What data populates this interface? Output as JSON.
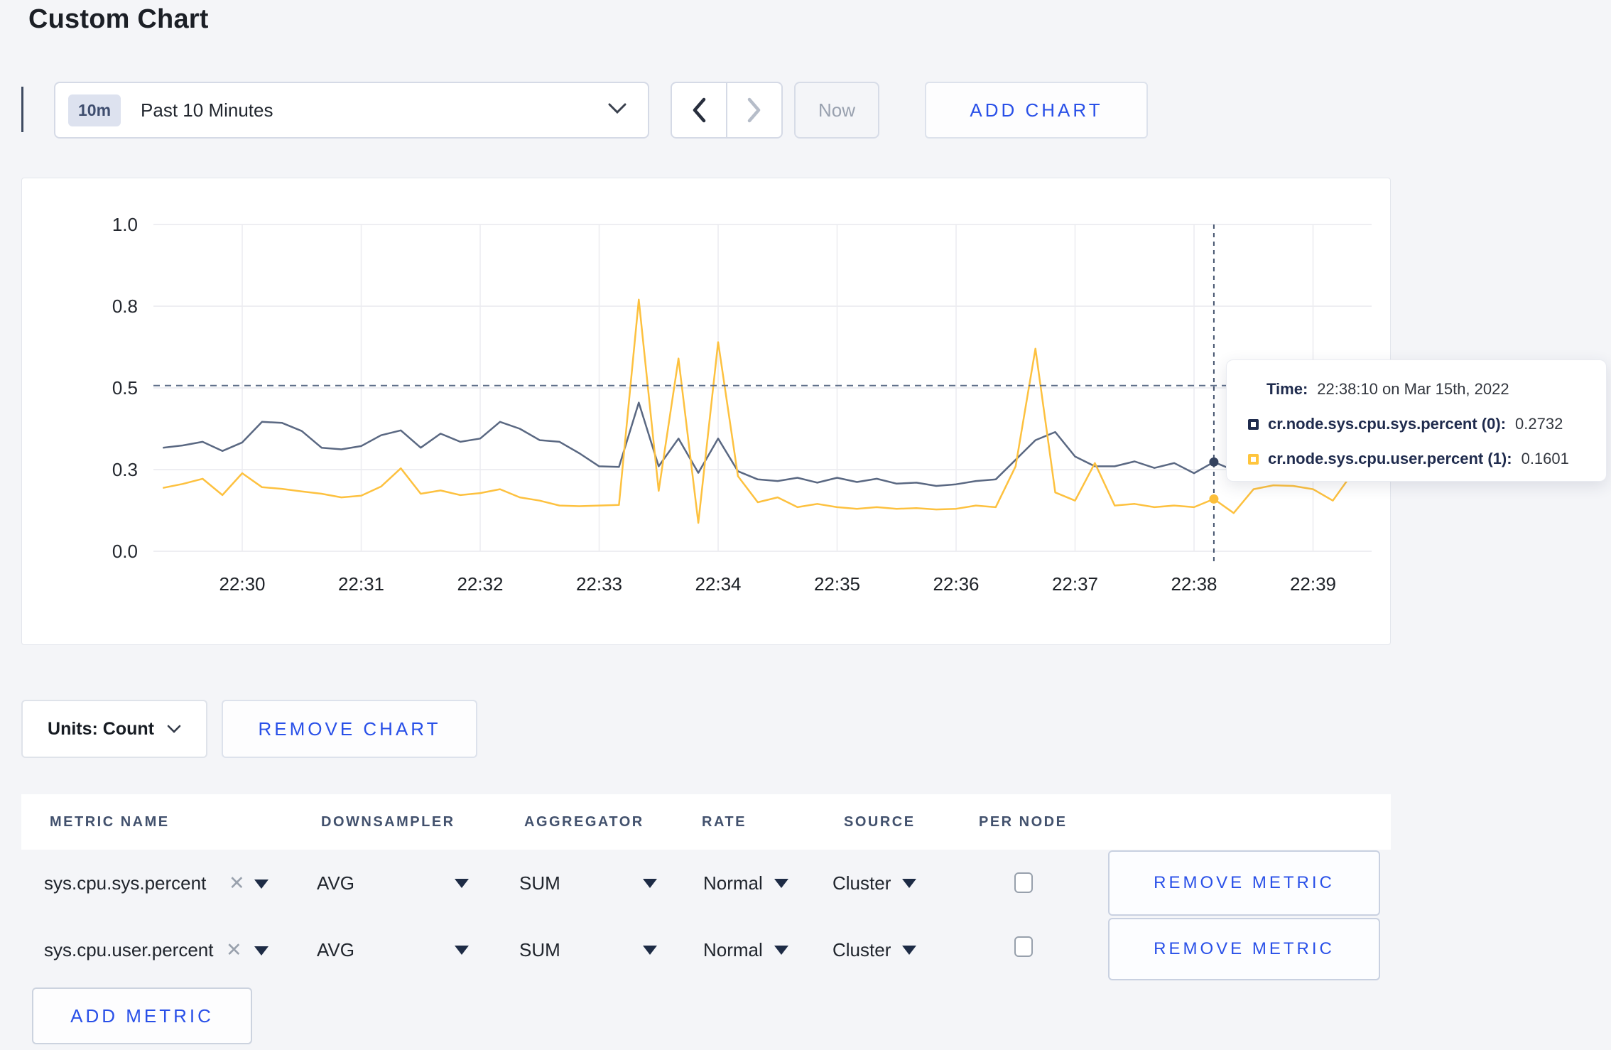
{
  "title": "Custom Chart",
  "toolbar": {
    "range_badge": "10m",
    "range_label": "Past 10 Minutes",
    "now_label": "Now",
    "add_chart_label": "ADD CHART"
  },
  "chart_controls": {
    "units_label": "Units: Count",
    "remove_chart_label": "REMOVE CHART",
    "add_metric_label": "ADD METRIC"
  },
  "tooltip": {
    "time_label": "Time:",
    "time_value": "22:38:10 on Mar 15th, 2022",
    "series": [
      {
        "label": "cr.node.sys.cpu.sys.percent (0):",
        "value": "0.2732",
        "color": "#1f2b4d"
      },
      {
        "label": "cr.node.sys.cpu.user.percent (1):",
        "value": "0.1601",
        "color": "#ffc53d"
      }
    ]
  },
  "table": {
    "headers": [
      "METRIC NAME",
      "DOWNSAMPLER",
      "AGGREGATOR",
      "RATE",
      "SOURCE",
      "PER NODE"
    ],
    "remove_metric_label": "REMOVE METRIC",
    "rows": [
      {
        "metric": "sys.cpu.sys.percent",
        "downsampler": "AVG",
        "aggregator": "SUM",
        "rate": "Normal",
        "source": "Cluster",
        "per_node_checked": false
      },
      {
        "metric": "sys.cpu.user.percent",
        "downsampler": "AVG",
        "aggregator": "SUM",
        "rate": "Normal",
        "source": "Cluster",
        "per_node_checked": false
      }
    ]
  },
  "colors": {
    "accent_blue": "#2950e8",
    "series_sys": "#5a6882",
    "series_user": "#fdc13f",
    "crosshair": "#45546f",
    "grid": "#e8e9ee"
  },
  "chart_data": {
    "type": "line",
    "title": "",
    "ylabel": "",
    "xlabel": "",
    "ylim": [
      0,
      1
    ],
    "grid": true,
    "legend": "tooltip",
    "y_tick_labels": [
      "0.0",
      "0.3",
      "0.5",
      "0.8",
      "1.0"
    ],
    "y_tick_values": [
      0,
      0.25,
      0.5,
      0.75,
      1.0
    ],
    "x_ticks": [
      "22:30",
      "22:31",
      "22:32",
      "22:33",
      "22:34",
      "22:35",
      "22:36",
      "22:37",
      "22:38",
      "22:39"
    ],
    "x_tick_seconds": [
      0,
      60,
      120,
      180,
      240,
      300,
      360,
      420,
      480,
      540
    ],
    "x_seconds": [
      -40,
      -30,
      -20,
      -10,
      0,
      10,
      20,
      30,
      40,
      50,
      60,
      70,
      80,
      90,
      100,
      110,
      120,
      130,
      140,
      150,
      160,
      170,
      180,
      190,
      200,
      210,
      220,
      230,
      240,
      250,
      260,
      270,
      280,
      290,
      300,
      310,
      320,
      330,
      340,
      350,
      360,
      370,
      380,
      390,
      400,
      410,
      420,
      430,
      440,
      450,
      460,
      470,
      480,
      490,
      500,
      510,
      520,
      530,
      540,
      550,
      560,
      570
    ],
    "series": [
      {
        "name": "cr.node.sys.cpu.sys.percent",
        "color": "#5a6882",
        "values": [
          0.317,
          0.324,
          0.335,
          0.307,
          0.333,
          0.396,
          0.393,
          0.368,
          0.317,
          0.312,
          0.322,
          0.355,
          0.37,
          0.317,
          0.36,
          0.335,
          0.345,
          0.396,
          0.375,
          0.34,
          0.335,
          0.3,
          0.26,
          0.258,
          0.455,
          0.26,
          0.345,
          0.24,
          0.345,
          0.245,
          0.22,
          0.215,
          0.225,
          0.21,
          0.225,
          0.212,
          0.222,
          0.207,
          0.21,
          0.2,
          0.205,
          0.215,
          0.22,
          0.28,
          0.34,
          0.365,
          0.29,
          0.26,
          0.26,
          0.275,
          0.255,
          0.27,
          0.239,
          0.2732,
          0.248,
          0.27,
          0.29,
          0.27,
          0.265,
          0.255,
          0.275,
          0.3
        ]
      },
      {
        "name": "cr.node.sys.cpu.user.percent",
        "color": "#fdc13f",
        "values": [
          0.194,
          0.206,
          0.222,
          0.172,
          0.239,
          0.196,
          0.191,
          0.183,
          0.176,
          0.165,
          0.17,
          0.198,
          0.254,
          0.176,
          0.186,
          0.172,
          0.178,
          0.19,
          0.165,
          0.155,
          0.14,
          0.138,
          0.14,
          0.142,
          0.77,
          0.185,
          0.59,
          0.087,
          0.64,
          0.23,
          0.15,
          0.165,
          0.135,
          0.145,
          0.135,
          0.13,
          0.135,
          0.13,
          0.132,
          0.128,
          0.13,
          0.14,
          0.135,
          0.26,
          0.62,
          0.18,
          0.155,
          0.27,
          0.14,
          0.145,
          0.135,
          0.14,
          0.135,
          0.1601,
          0.117,
          0.19,
          0.202,
          0.2,
          0.19,
          0.155,
          0.24,
          0.26
        ]
      }
    ],
    "crosshair": {
      "x_seconds": 490,
      "x_label": "22:38:10",
      "hline_value": 0.507,
      "points": [
        {
          "series": 0,
          "value": 0.2732
        },
        {
          "series": 1,
          "value": 0.1601
        }
      ]
    }
  }
}
